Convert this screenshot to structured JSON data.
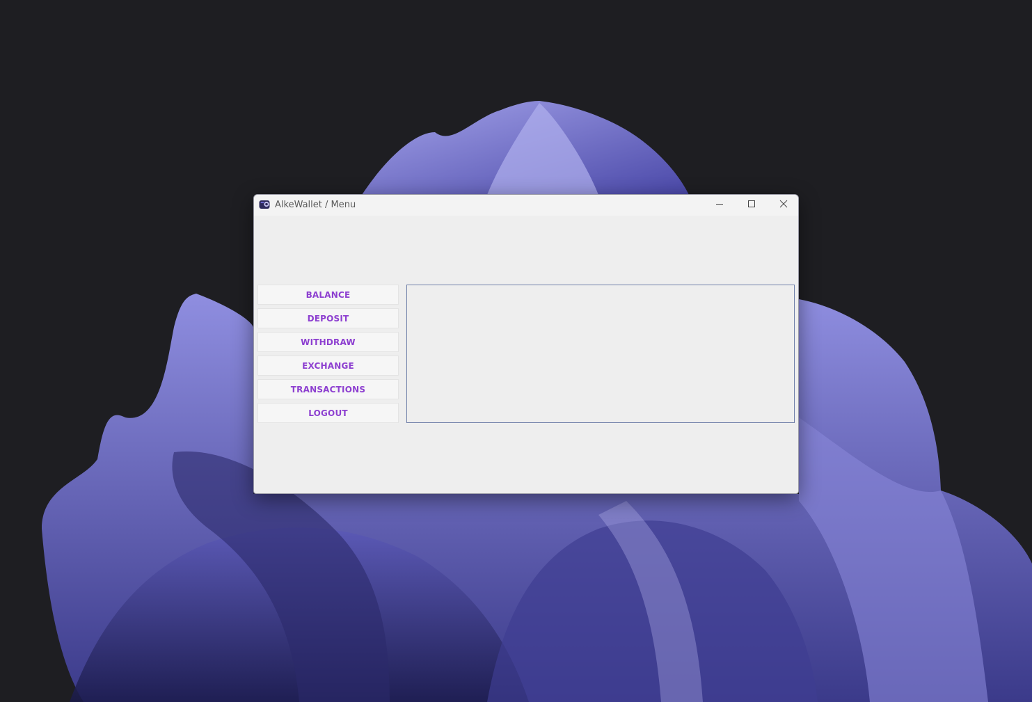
{
  "window": {
    "title": "AlkeWallet / Menu"
  },
  "menu": {
    "items": [
      {
        "label": "BALANCE"
      },
      {
        "label": "DEPOSIT"
      },
      {
        "label": "WITHDRAW"
      },
      {
        "label": "EXCHANGE"
      },
      {
        "label": "TRANSACTIONS"
      },
      {
        "label": "LOGOUT"
      }
    ]
  },
  "icons": {
    "app": "wallet-icon",
    "minimize": "minimize-icon",
    "maximize": "maximize-icon",
    "close": "close-icon"
  },
  "colors": {
    "accent": "#8d3fd0",
    "panel_border": "#6e7ea8",
    "desktop_bg": "#1e1e22",
    "wallpaper": "#6a68c8"
  }
}
